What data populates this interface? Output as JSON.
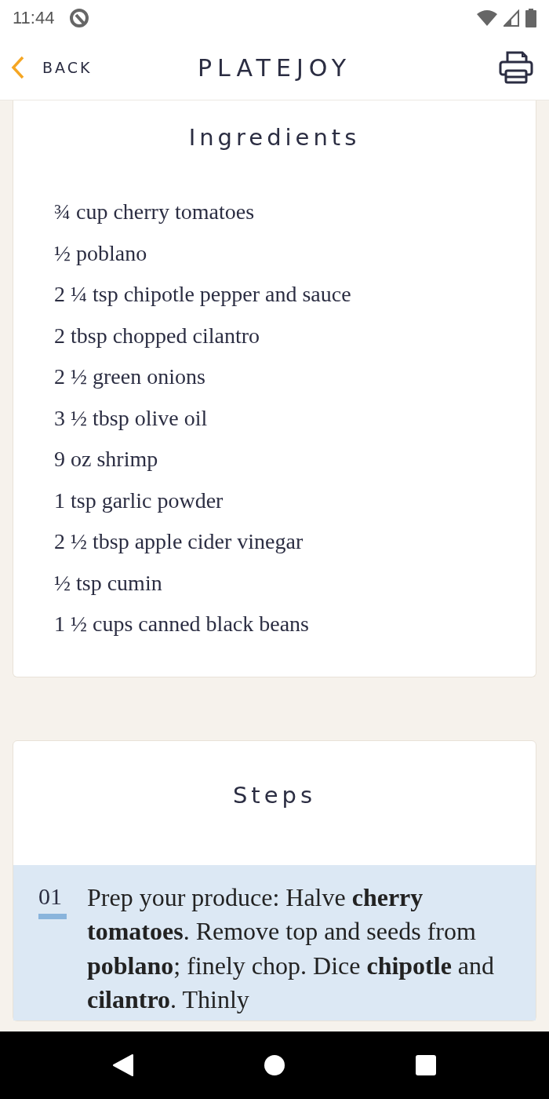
{
  "status_bar": {
    "time": "11:44"
  },
  "header": {
    "back": "BACK",
    "logo": "PLATEJOY"
  },
  "ingredients": {
    "title": "Ingredients",
    "items": [
      "¾ cup cherry tomatoes",
      "½ poblano",
      "2 ¼ tsp chipotle pepper and sauce",
      "2 tbsp chopped cilantro",
      "2 ½ green onions",
      "3 ½ tbsp olive oil",
      "9 oz shrimp",
      "1 tsp garlic powder",
      "2 ½ tbsp apple cider vinegar",
      "½ tsp cumin",
      "1 ½ cups canned black beans"
    ]
  },
  "steps": {
    "title": "Steps",
    "items": [
      {
        "number": "01",
        "text": "Prep your produce: Halve **cherry tomatoes**. Remove top and seeds from **poblano**; finely chop. Dice **chipotle** and **cilantro**. Thinly",
        "selected": true
      }
    ]
  }
}
